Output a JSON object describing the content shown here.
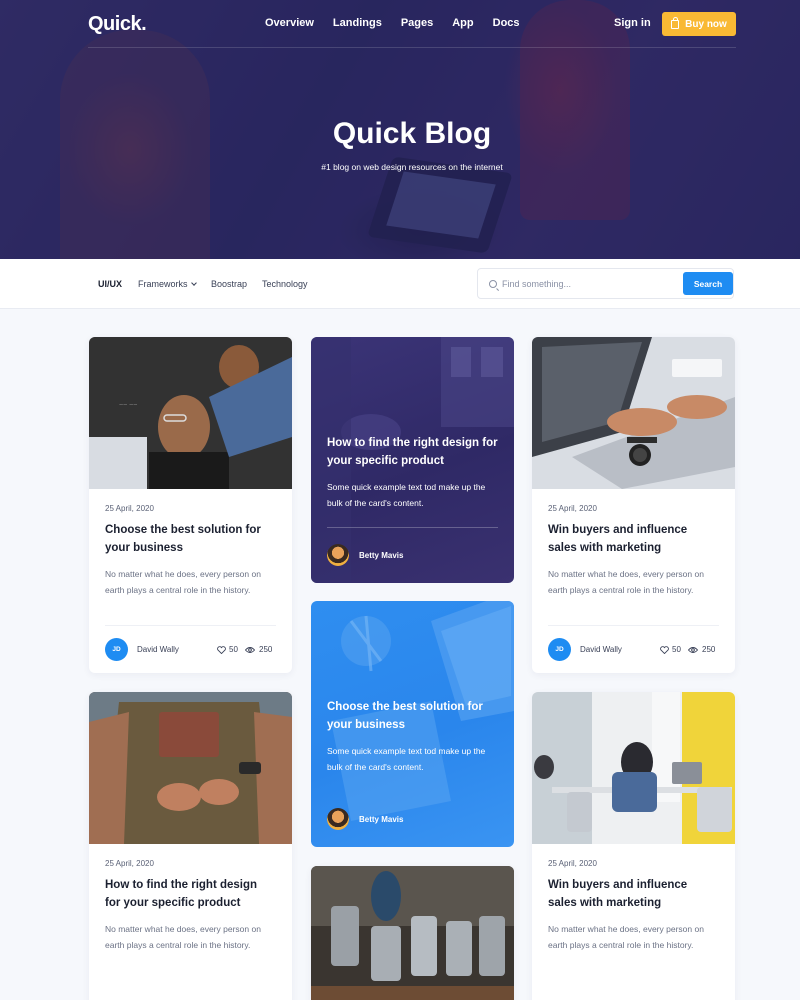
{
  "nav": {
    "logo": "Quick.",
    "links": [
      "Overview",
      "Landings",
      "Pages",
      "App",
      "Docs"
    ],
    "signin": "Sign in",
    "buy": "Buy now"
  },
  "hero": {
    "title": "Quick Blog",
    "subtitle": "#1 blog on web design resources on the internet"
  },
  "filters": {
    "items": [
      "UI/UX",
      "Frameworks",
      "Boostrap",
      "Technology"
    ],
    "search_placeholder": "Find something...",
    "search_button": "Search"
  },
  "cards": [
    {
      "date": "25 April, 2020",
      "title": "Choose the best solution for your business",
      "text": "No matter what he does, every person on earth plays a central role in the history.",
      "author_initials": "JD",
      "author": "David Wally",
      "likes": "50",
      "views": "250"
    },
    {
      "date": "25 April, 2020",
      "title": "Win buyers and influence sales with marketing",
      "text": "No matter what he does, every person on earth plays a central role in the history.",
      "author_initials": "JD",
      "author": "David Wally",
      "likes": "50",
      "views": "250"
    },
    {
      "date": "25 April, 2020",
      "title": "How to find the right design for your specific product",
      "text": "No matter what he does, every person on earth plays a central role in the history."
    },
    {
      "date": "25 April, 2020",
      "title": "Win buyers and influence sales with marketing",
      "text": "No matter what he does, every person on earth plays a central role in the history."
    }
  ],
  "overlay_cards": [
    {
      "title": "How to find the right design for your specific product",
      "text": "Some quick example text tod make up the bulk of the card's content.",
      "author": "Betty Mavis"
    },
    {
      "title": "Choose the best solution for your business",
      "text": "Some quick example text tod make up the bulk of the card's content.",
      "author": "Betty Mavis"
    }
  ],
  "colors": {
    "primary": "#1e8cf2",
    "accent": "#f9b934",
    "hero_overlay": "#262262"
  }
}
